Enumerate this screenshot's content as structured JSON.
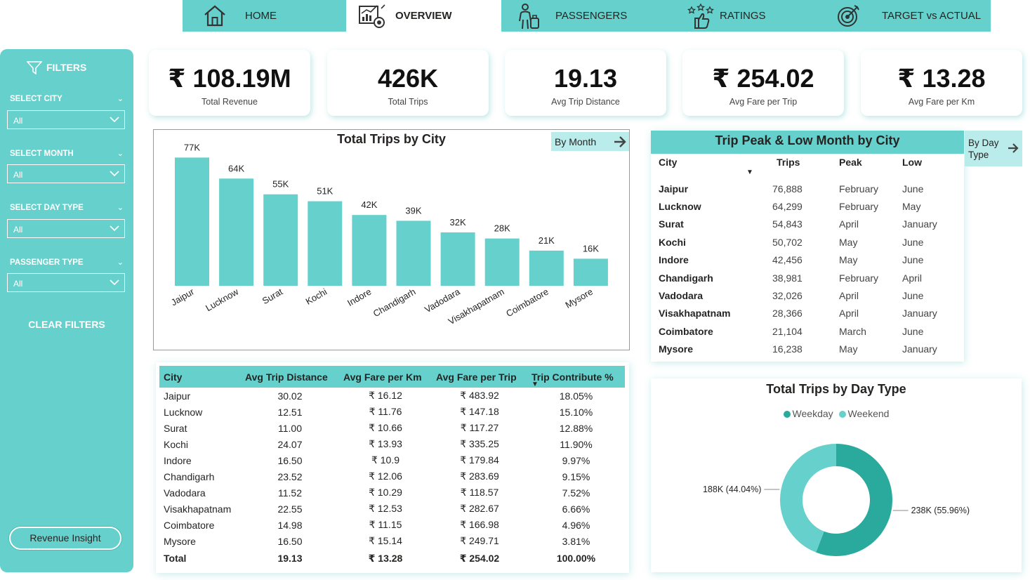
{
  "nav": {
    "tabs": [
      {
        "label": "HOME",
        "icon": "home-icon"
      },
      {
        "label": "OVERVIEW",
        "icon": "dashboard-icon"
      },
      {
        "label": "PASSENGERS",
        "icon": "passenger-icon"
      },
      {
        "label": "RATINGS",
        "icon": "ratings-icon"
      },
      {
        "label": "TARGET vs ACTUAL",
        "icon": "target-icon"
      }
    ],
    "active": "OVERVIEW"
  },
  "sidebar": {
    "title": "FILTERS",
    "filters": [
      {
        "label": "SELECT CITY",
        "value": "All"
      },
      {
        "label": "SELECT MONTH",
        "value": "All"
      },
      {
        "label": "SELECT DAY TYPE",
        "value": "All"
      },
      {
        "label": "PASSENGER TYPE",
        "value": "All"
      }
    ],
    "clear_label": "CLEAR FILTERS",
    "insight_button": "Revenue Insight"
  },
  "kpis": [
    {
      "value": "₹ 108.19M",
      "label": "Total Revenue"
    },
    {
      "value": "426K",
      "label": "Total Trips"
    },
    {
      "value": "19.13",
      "label": "Avg Trip Distance"
    },
    {
      "value": "₹ 254.02",
      "label": "Avg Fare per Trip"
    },
    {
      "value": "₹ 13.28",
      "label": "Avg Fare per Km"
    }
  ],
  "trips_chart": {
    "drill_label": "By Month",
    "chart_data": {
      "type": "bar",
      "title": "Total Trips by City",
      "categories": [
        "Jaipur",
        "Lucknow",
        "Surat",
        "Kochi",
        "Indore",
        "Chandigarh",
        "Vadodara",
        "Visakhapatnam",
        "Coimbatore",
        "Mysore"
      ],
      "values": [
        76888,
        64299,
        54843,
        50702,
        42456,
        38981,
        32026,
        28366,
        21104,
        16238
      ],
      "data_labels": [
        "77K",
        "64K",
        "55K",
        "51K",
        "42K",
        "39K",
        "32K",
        "28K",
        "21K",
        "16K"
      ],
      "ylim": [
        0,
        80000
      ],
      "grid": false,
      "color": "#66d1cc"
    }
  },
  "peak_table": {
    "title": "Trip Peak & Low Month by City",
    "drill_label": "By Day Type",
    "columns": [
      "City",
      "Trips",
      "Peak",
      "Low"
    ],
    "rows": [
      [
        "Jaipur",
        "76,888",
        "February",
        "June"
      ],
      [
        "Lucknow",
        "64,299",
        "February",
        "May"
      ],
      [
        "Surat",
        "54,843",
        "April",
        "January"
      ],
      [
        "Kochi",
        "50,702",
        "May",
        "June"
      ],
      [
        "Indore",
        "42,456",
        "May",
        "June"
      ],
      [
        "Chandigarh",
        "38,981",
        "February",
        "April"
      ],
      [
        "Vadodara",
        "32,026",
        "April",
        "June"
      ],
      [
        "Visakhapatnam",
        "28,366",
        "April",
        "January"
      ],
      [
        "Coimbatore",
        "21,104",
        "March",
        "June"
      ],
      [
        "Mysore",
        "16,238",
        "May",
        "January"
      ]
    ]
  },
  "city_table": {
    "columns": [
      "City",
      "Avg Trip Distance",
      "Avg Fare per Km",
      "Avg Fare per Trip",
      "Trip Contribute %"
    ],
    "rows": [
      [
        "Jaipur",
        "30.02",
        "₹ 16.12",
        "₹ 483.92",
        "18.05%"
      ],
      [
        "Lucknow",
        "12.51",
        "₹ 11.76",
        "₹ 147.18",
        "15.10%"
      ],
      [
        "Surat",
        "11.00",
        "₹ 10.66",
        "₹ 117.27",
        "12.88%"
      ],
      [
        "Kochi",
        "24.07",
        "₹ 13.93",
        "₹ 335.25",
        "11.90%"
      ],
      [
        "Indore",
        "16.50",
        "₹ 10.9",
        "₹ 179.84",
        "9.97%"
      ],
      [
        "Chandigarh",
        "23.52",
        "₹ 12.06",
        "₹ 283.69",
        "9.15%"
      ],
      [
        "Vadodara",
        "11.52",
        "₹ 10.29",
        "₹ 118.57",
        "7.52%"
      ],
      [
        "Visakhapatnam",
        "22.55",
        "₹ 12.53",
        "₹ 282.67",
        "6.66%"
      ],
      [
        "Coimbatore",
        "14.98",
        "₹ 11.15",
        "₹ 166.98",
        "4.96%"
      ],
      [
        "Mysore",
        "16.50",
        "₹ 15.14",
        "₹ 249.71",
        "3.81%"
      ]
    ],
    "total": [
      "Total",
      "19.13",
      "₹ 13.28",
      "₹ 254.02",
      "100.00%"
    ]
  },
  "donut": {
    "chart_data": {
      "type": "pie",
      "title": "Total Trips by Day Type",
      "categories": [
        "Weekday",
        "Weekend"
      ],
      "values": [
        238000,
        188000
      ],
      "percent": [
        55.96,
        44.04
      ],
      "data_labels": [
        "238K (55.96%)",
        "188K (44.04%)"
      ],
      "colors": [
        "#2aa99d",
        "#66d1cc"
      ],
      "legend": "top"
    }
  }
}
